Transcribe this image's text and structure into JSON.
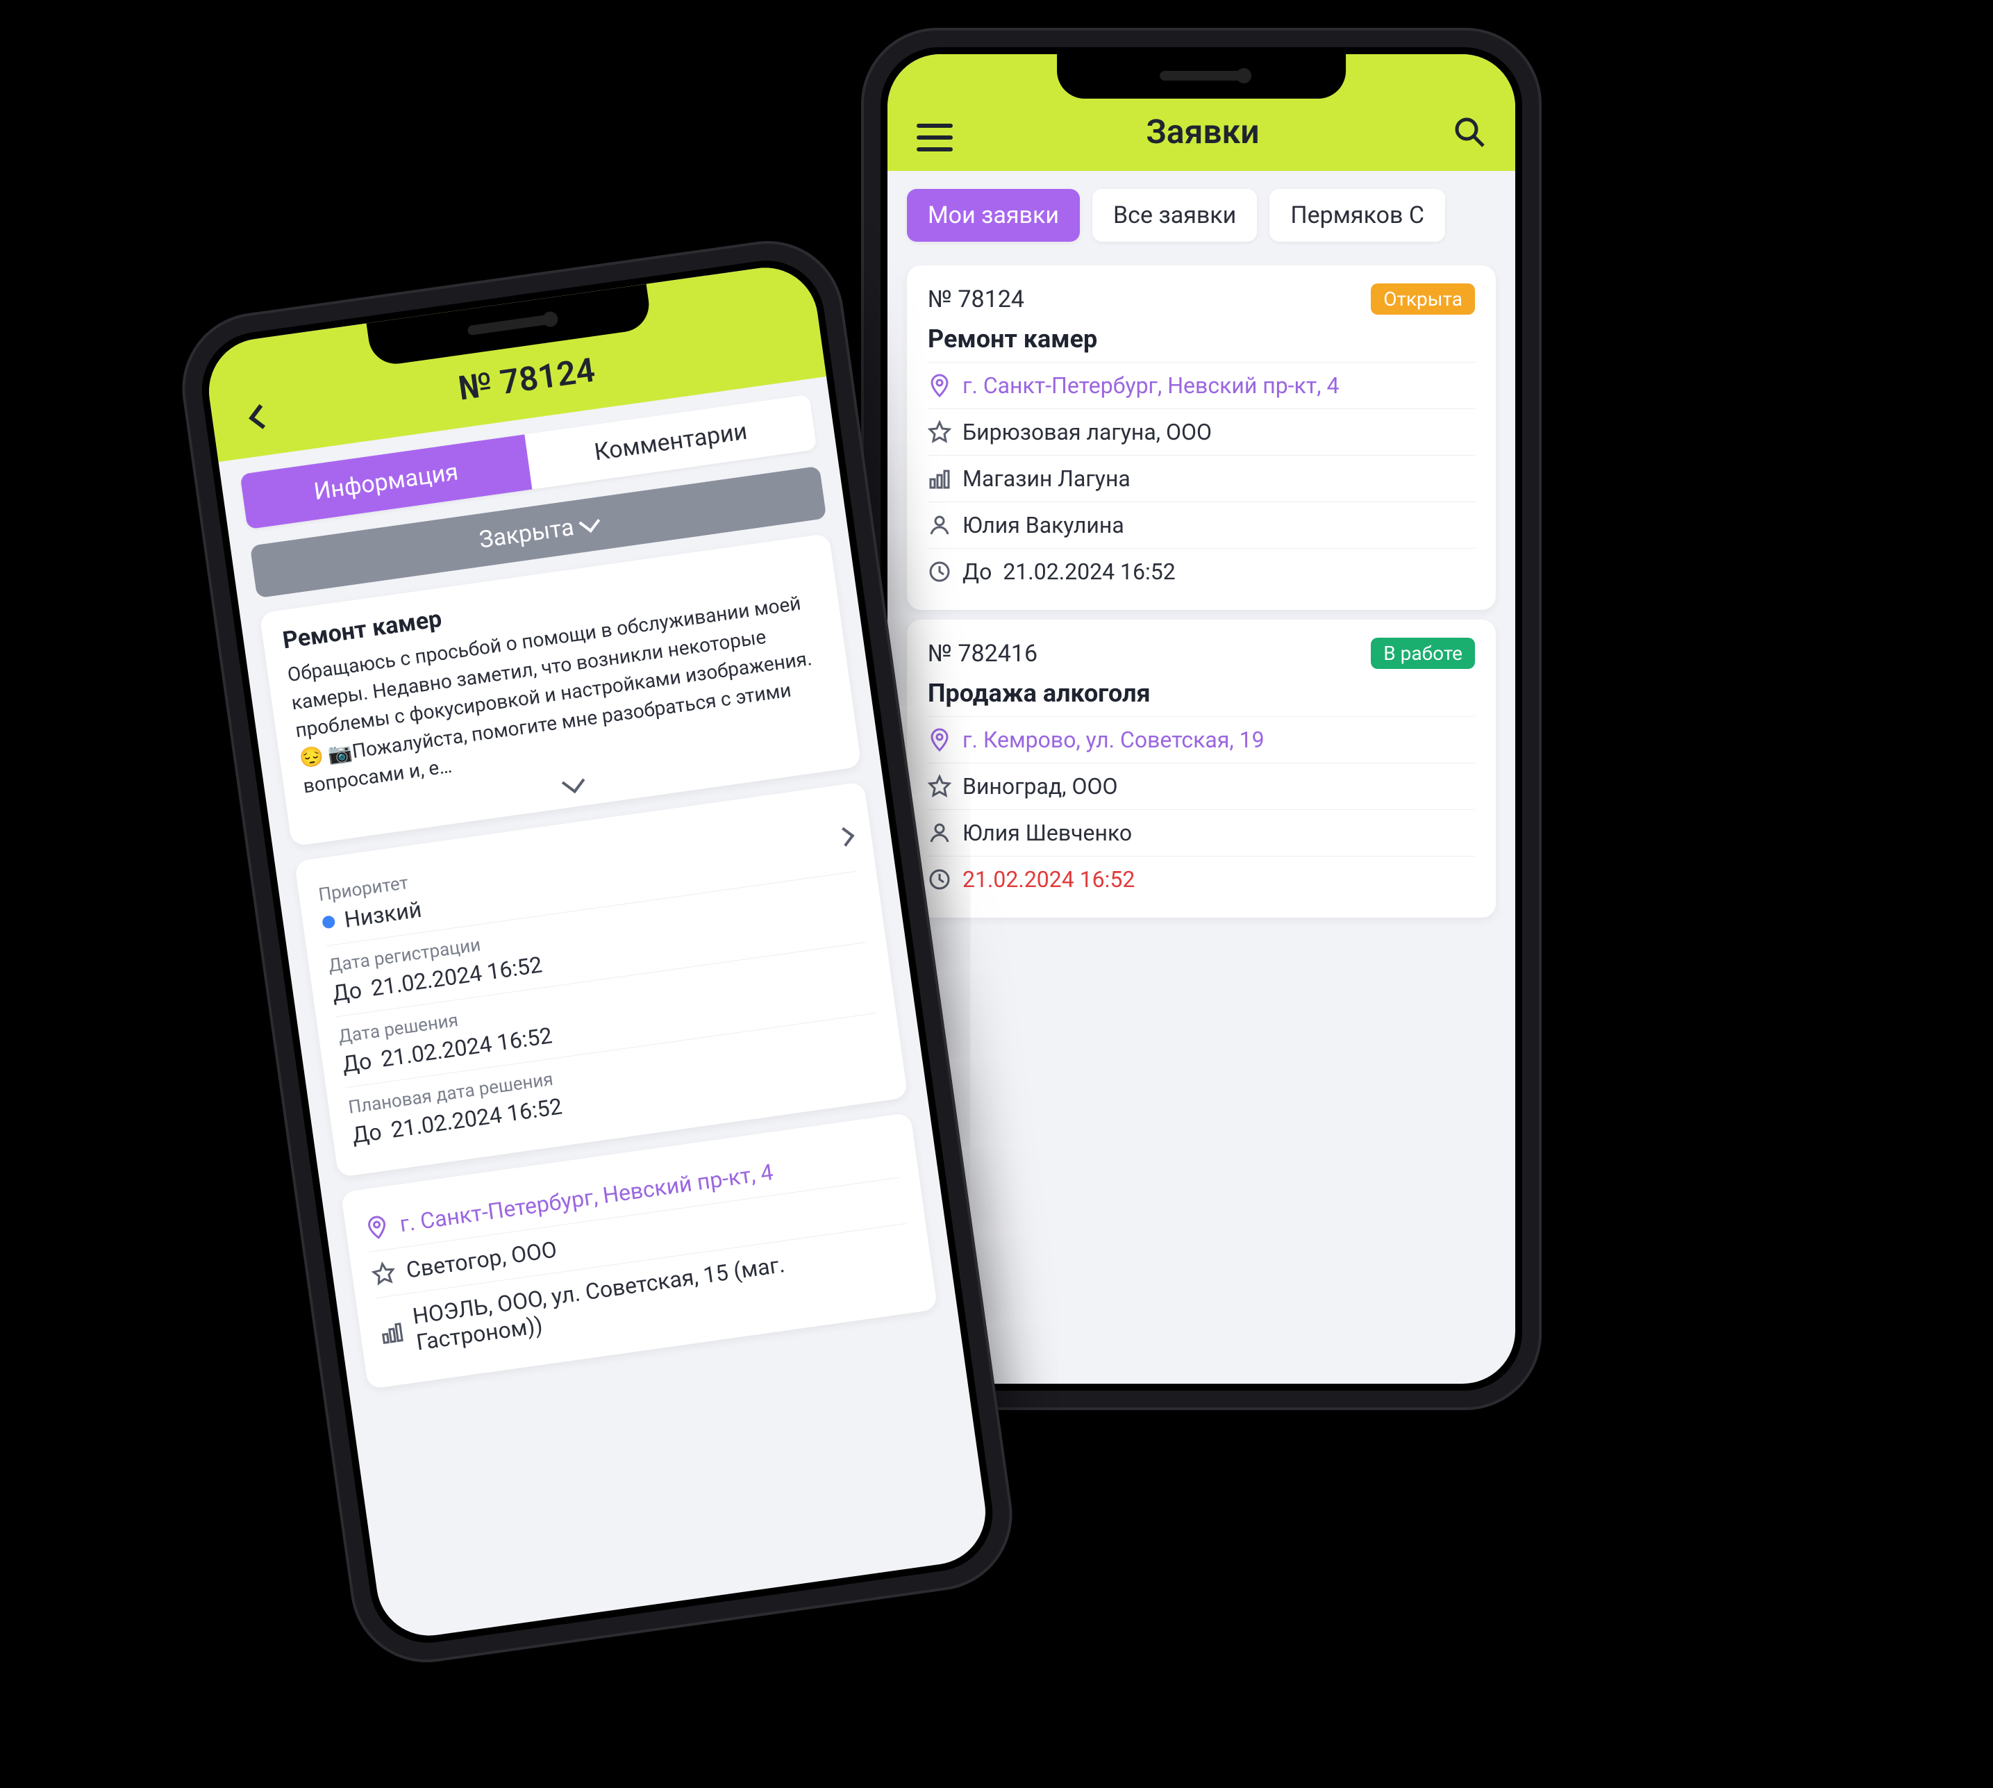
{
  "phoneB": {
    "header": {
      "title": "Заявки"
    },
    "filters": [
      {
        "label": "Мои заявки",
        "active": true
      },
      {
        "label": "Все заявки",
        "active": false
      },
      {
        "label": "Пермяков С",
        "active": false
      }
    ],
    "tickets": [
      {
        "number": "№ 78124",
        "status": {
          "label": "Открыта",
          "color": "orange"
        },
        "title": "Ремонт камер",
        "address": "г. Санкт-Петербург, Невский пр-кт, 4",
        "company": "Бирюзовая лагуна, ООО",
        "store": "Магазин Лагуна",
        "person": "Юлия Вакулина",
        "due_prefix": "До",
        "due": "21.02.2024  16:52",
        "due_red": false
      },
      {
        "number": "№ 782416",
        "status": {
          "label": "В работе",
          "color": "green"
        },
        "title": "Продажа алкоголя",
        "address": "г. Кемрово, ул. Советская, 19",
        "company": "Виноград, ООО",
        "store": "",
        "person": "Юлия Шевченко",
        "due_prefix": "",
        "due": "21.02.2024  16:52",
        "due_red": true
      }
    ]
  },
  "phoneA": {
    "header": {
      "title": "№ 78124"
    },
    "tabs": [
      {
        "label": "Информация",
        "active": true
      },
      {
        "label": "Комментарии",
        "active": false
      }
    ],
    "status": "Закрыта",
    "subject": "Ремонт камер",
    "description": "Обращаюсь с просьбой о помощи в обслуживании моей камеры. Недавно заметил, что возникли некоторые проблемы с фокусировкой и настройками изображения. 😔 📷Пожалуйста, помогите мне разобраться с этими вопросами и, е…",
    "priority": {
      "label": "Приоритет",
      "value": "Низкий"
    },
    "dates": {
      "reg": {
        "label": "Дата регистрации",
        "prefix": "До",
        "value": "21.02.2024  16:52"
      },
      "solve": {
        "label": "Дата решения",
        "prefix": "До",
        "value": "21.02.2024  16:52"
      },
      "plan": {
        "label": "Плановая дата решения",
        "prefix": "До",
        "value": "21.02.2024  16:52"
      }
    },
    "location": {
      "address": "г. Санкт-Петербург, Невский пр-кт, 4",
      "company": "Светогор, ООО",
      "store": "НОЭЛЬ, ООО, ул. Советская, 15 (маг. Гастроном))"
    }
  }
}
